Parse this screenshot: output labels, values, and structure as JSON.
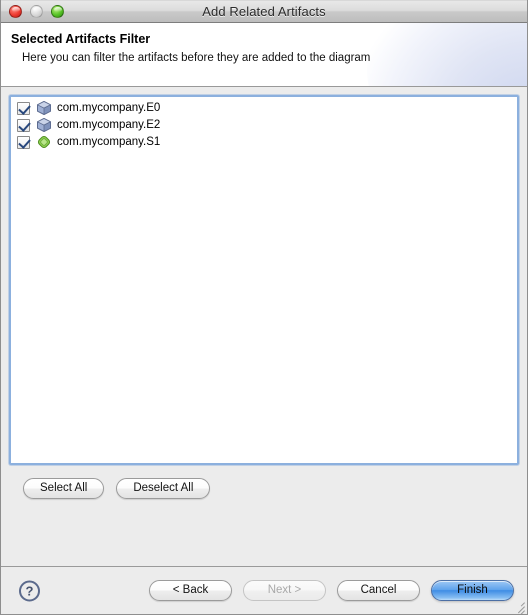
{
  "window": {
    "title": "Add Related Artifacts",
    "traffic_lights": [
      {
        "name": "close",
        "label": "close-button",
        "enabled": true
      },
      {
        "name": "minimize",
        "label": "minimize-button",
        "enabled": false
      },
      {
        "name": "zoom",
        "label": "zoom-button",
        "enabled": true
      }
    ]
  },
  "header": {
    "title": "Selected Artifacts Filter",
    "description": "Here you can filter the artifacts before they are added to the diagram"
  },
  "list": {
    "items": [
      {
        "label": "com.mycompany.E0",
        "checked": true,
        "icon": "blue-cube-icon"
      },
      {
        "label": "com.mycompany.E2",
        "checked": true,
        "icon": "blue-cube-icon"
      },
      {
        "label": "com.mycompany.S1",
        "checked": true,
        "icon": "green-diamond-icon"
      }
    ]
  },
  "selection_buttons": {
    "select_all": "Select All",
    "deselect_all": "Deselect All"
  },
  "footer": {
    "help": "?",
    "back": "< Back",
    "next": "Next >",
    "cancel": "Cancel",
    "finish": "Finish"
  },
  "colors": {
    "focus_border": "#8cb0de",
    "default_button": "#3e8ce4",
    "window_background": "#ececec",
    "header_background": "#ffffff"
  }
}
